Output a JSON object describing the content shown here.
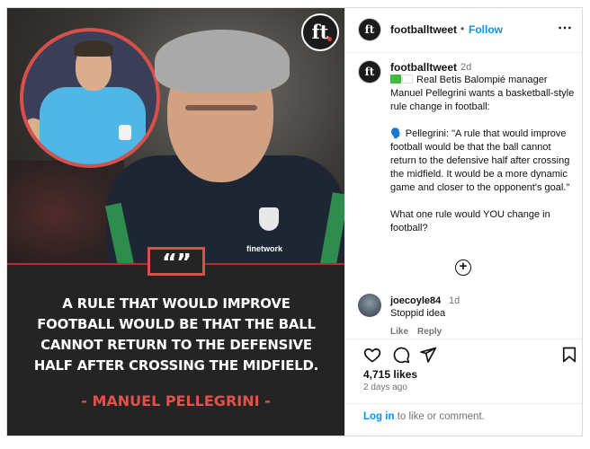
{
  "image": {
    "logo_text": "ft",
    "sponsor": "finetwork",
    "quote_mark": "“”",
    "quote": "A RULE THAT WOULD IMPROVE FOOTBALL WOULD BE THAT THE BALL CANNOT RETURN TO THE DEFENSIVE HALF AFTER CROSSING THE MIDFIELD.",
    "author": "- MANUEL PELLEGRINI -"
  },
  "header": {
    "avatar_text": "ft",
    "username": "footballtweet",
    "separator": "•",
    "follow_label": "Follow",
    "more_icon": "⋯"
  },
  "caption": {
    "avatar_text": "ft",
    "username": "footballtweet",
    "time": "2d",
    "line1": "Real Betis Balompié manager Manuel Pellegrini wants a basketball-style rule change in football:",
    "line2": "🗣️ Pellegrini: \"A rule that would improve football would be that the ball cannot return to the defensive half after crossing the midfield. It would be a more dynamic game and closer to the opponent's goal.\"",
    "line3": "What one rule would YOU change in football?"
  },
  "add_comment_icon": "+",
  "comment": {
    "username": "joecoyle84",
    "time": "1d",
    "text": "Stoppid idea",
    "like_label": "Like",
    "reply_label": "Reply"
  },
  "stats": {
    "likes": "4,715 likes",
    "ago": "2 days ago"
  },
  "login": {
    "link": "Log in",
    "rest": " to like or comment."
  },
  "colors": {
    "accent_red": "#d8504a",
    "link_blue": "#0095f6",
    "betis_green": "#3dbb3d"
  }
}
